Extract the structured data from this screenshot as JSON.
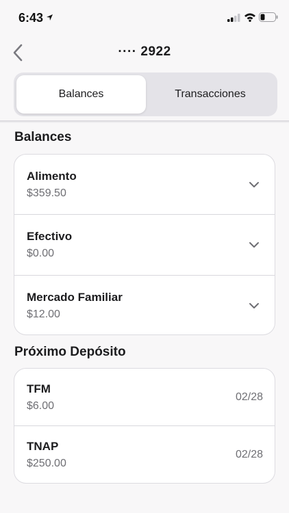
{
  "status_bar": {
    "time": "6:43",
    "icons": [
      "location-arrow-icon",
      "cellular-signal-icon",
      "wifi-icon",
      "battery-icon"
    ]
  },
  "nav": {
    "title": "···· 2922",
    "back_icon": "chevron-left-icon"
  },
  "tabs": [
    {
      "label": "Balances",
      "selected": true
    },
    {
      "label": "Transacciones",
      "selected": false
    }
  ],
  "balances": {
    "title": "Balances",
    "items": [
      {
        "name": "Alimento",
        "amount": "$359.50"
      },
      {
        "name": "Efectivo",
        "amount": "$0.00"
      },
      {
        "name": "Mercado Familiar",
        "amount": "$12.00"
      }
    ]
  },
  "deposits": {
    "title": "Próximo Depósito",
    "items": [
      {
        "name": "TFM",
        "amount": "$6.00",
        "date": "02/28"
      },
      {
        "name": "TNAP",
        "amount": "$250.00",
        "date": "02/28"
      }
    ]
  },
  "colors": {
    "background": "#f8f7f8",
    "card": "#ffffff",
    "segment_track": "#e4e3e8",
    "secondary_text": "#6e6e73"
  }
}
